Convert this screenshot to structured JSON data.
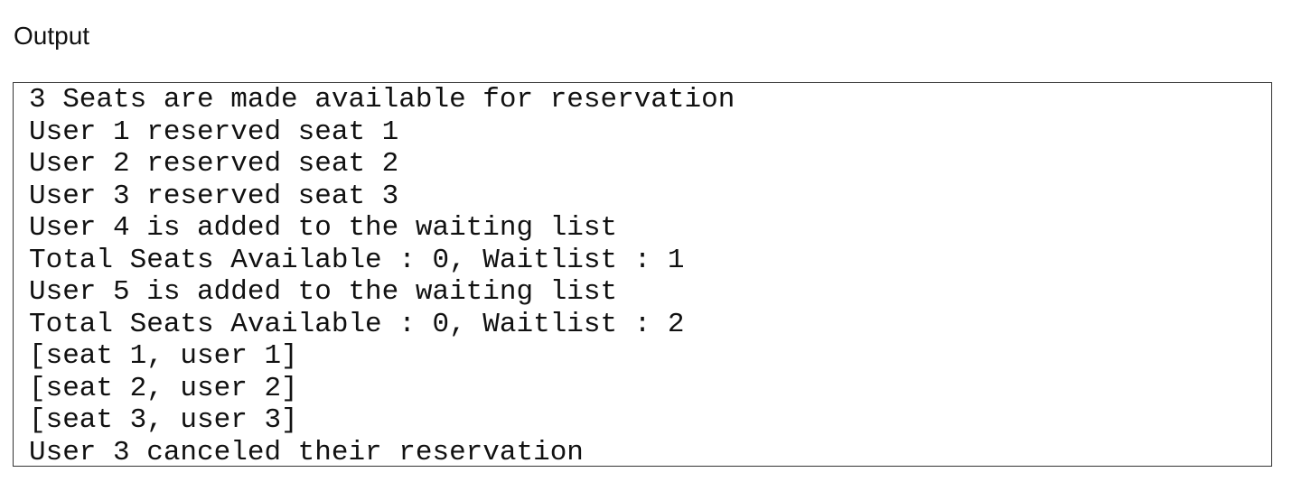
{
  "heading": "Output",
  "output_lines": [
    "3 Seats are made available for reservation",
    "User 1 reserved seat 1",
    "User 2 reserved seat 2",
    "User 3 reserved seat 3",
    "User 4 is added to the waiting list",
    "Total Seats Available : 0, Waitlist : 1",
    "User 5 is added to the waiting list",
    "Total Seats Available : 0, Waitlist : 2",
    "[seat 1, user 1]",
    "[seat 2, user 2]",
    "[seat 3, user 3]",
    "User 3 canceled their reservation"
  ],
  "colors": {
    "text": "#111111",
    "border": "#333333",
    "background": "#ffffff"
  }
}
